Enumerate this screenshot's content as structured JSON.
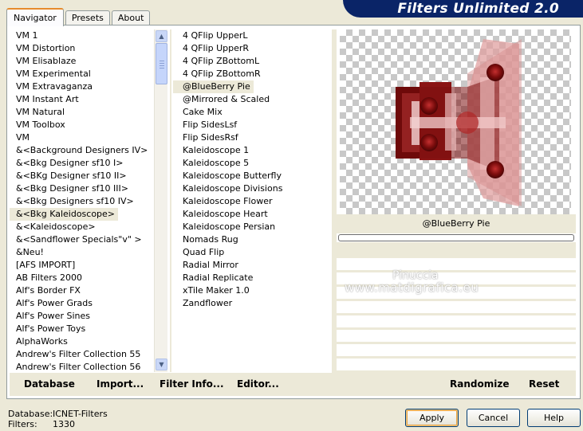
{
  "header": {
    "title": "Filters Unlimited 2.0"
  },
  "tabs": [
    {
      "label": "Navigator",
      "active": true
    },
    {
      "label": "Presets",
      "active": false
    },
    {
      "label": "About",
      "active": false
    }
  ],
  "categories": {
    "items": [
      "VM 1",
      "VM Distortion",
      "VM Elisablaze",
      "VM Experimental",
      "VM Extravaganza",
      "VM Instant Art",
      "VM Natural",
      "VM Toolbox",
      "VM",
      "&<Background Designers IV>",
      "&<Bkg Designer sf10 I>",
      "&<BKg Designer sf10 II>",
      "&<Bkg Designer sf10 III>",
      "&<Bkg Designers sf10 IV>",
      "&<Bkg Kaleidoscope>",
      "&<Kaleidoscope>",
      "&<Sandflower Specials\"v\" >",
      "&Neu!",
      "[AFS IMPORT]",
      "AB Filters 2000",
      "Alf's Border FX",
      "Alf's Power Grads",
      "Alf's Power Sines",
      "Alf's Power Toys",
      "AlphaWorks",
      "Andrew's Filter Collection 55",
      "Andrew's Filter Collection 56"
    ],
    "selected": "&<Bkg Kaleidoscope>"
  },
  "filters": {
    "items": [
      "4 QFlip UpperL",
      "4 QFlip UpperR",
      "4 QFlip ZBottomL",
      "4 QFlip ZBottomR",
      "@BlueBerry Pie",
      "@Mirrored & Scaled",
      "Cake Mix",
      "Flip SidesLsf",
      "Flip SidesRsf",
      "Kaleidoscope 1",
      "Kaleidoscope 5",
      "Kaleidoscope Butterfly",
      "Kaleidoscope Divisions",
      "Kaleidoscope Flower",
      "Kaleidoscope Heart",
      "Kaleidoscope Persian",
      "Nomads Rug",
      "Quad Flip",
      "Radial Mirror",
      "Radial Replicate",
      "xTile Maker 1.0",
      "Zandflower"
    ],
    "selected": "@BlueBerry Pie"
  },
  "preview": {
    "filter_name": "@BlueBerry Pie"
  },
  "watermark": {
    "line1": "Pinuccia",
    "line2": "www.matdigrafica.eu"
  },
  "toolbar": {
    "database": "Database",
    "import": "Import...",
    "filter_info": "Filter Info...",
    "editor": "Editor...",
    "randomize": "Randomize",
    "reset": "Reset"
  },
  "status": {
    "database_label": "Database:",
    "database_value": "ICNET-Filters",
    "filters_label": "Filters:",
    "filters_value": "1330"
  },
  "buttons": {
    "apply": "Apply",
    "cancel": "Cancel",
    "help": "Help"
  },
  "icons": {
    "scroll_up": "chevron-up-icon",
    "scroll_down": "chevron-down-icon"
  },
  "colors": {
    "accent": "#0a2467",
    "preview_dark": "#6b0a0a",
    "preview_light": "#e8a8a8"
  }
}
